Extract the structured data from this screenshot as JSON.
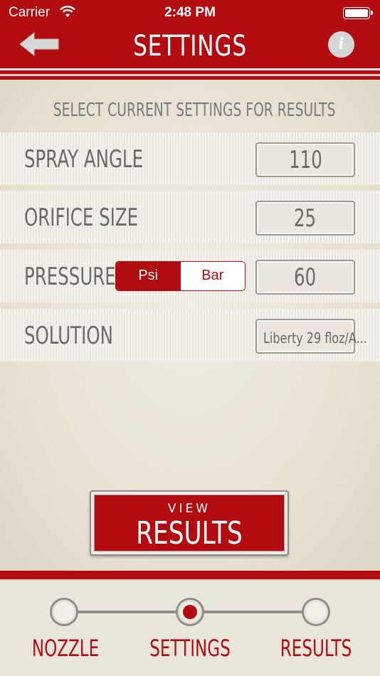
{
  "status_bar": {
    "carrier": "Carrier",
    "time": "2:48 PM"
  },
  "header": {
    "title": "SETTINGS",
    "back_icon": "arrow-left-icon",
    "info_icon": "info-icon",
    "info_glyph": "i"
  },
  "instructions": "SELECT CURRENT SETTINGS FOR RESULTS",
  "rows": [
    {
      "label": "SPRAY ANGLE",
      "value": "110"
    },
    {
      "label": "ORIFICE SIZE",
      "value": "25"
    },
    {
      "label": "PRESSURE",
      "value": "60",
      "units": [
        "Psi",
        "Bar"
      ],
      "selected_unit": "Psi"
    },
    {
      "label": "SOLUTION",
      "value": "Liberty 29 floz/A..."
    }
  ],
  "view_results": {
    "line1": "VIEW",
    "line2": "RESULTS"
  },
  "steps": [
    {
      "label": "NOZZLE",
      "state": "completed"
    },
    {
      "label": "SETTINGS",
      "state": "current"
    },
    {
      "label": "RESULTS",
      "state": "pending"
    }
  ],
  "colors": {
    "brand_red": "#b30c10",
    "text_gray": "#6a6a6a",
    "background": "#e9e4da"
  }
}
